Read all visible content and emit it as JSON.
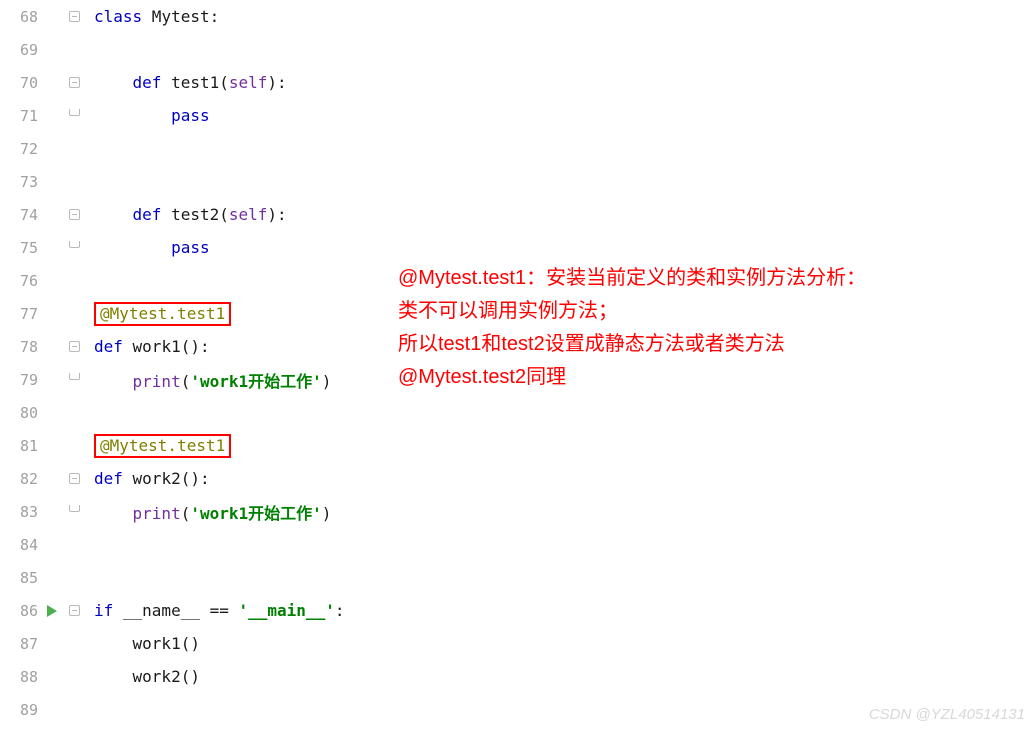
{
  "lines": {
    "l68": "68",
    "l69": "69",
    "l70": "70",
    "l71": "71",
    "l72": "72",
    "l73": "73",
    "l74": "74",
    "l75": "75",
    "l76": "76",
    "l77": "77",
    "l78": "78",
    "l79": "79",
    "l80": "80",
    "l81": "81",
    "l82": "82",
    "l83": "83",
    "l84": "84",
    "l85": "85",
    "l86": "86",
    "l87": "87",
    "l88": "88",
    "l89": "89"
  },
  "code": {
    "class_kw": "class",
    "class_name": " Mytest:",
    "def_kw": "def",
    "test1": " test1(",
    "test2": " test2(",
    "self_kw": "self",
    "close_def": "):",
    "pass_kw": "pass",
    "decorator1": "@Mytest.test1",
    "decorator2": "@Mytest.test1",
    "work1_def": " work1():",
    "work2_def": " work2():",
    "print_kw": "print",
    "print_open": "(",
    "print_close": ")",
    "work1_str": "'work1开始工作'",
    "work2_str": "'work1开始工作'",
    "if_kw": "if",
    "name_dunder": " __name__ == ",
    "main_str": "'__main__'",
    "colon": ":",
    "call_work1": "work1()",
    "call_work2": "work2()"
  },
  "annotation": {
    "l1": "@Mytest.test1：安装当前定义的类和实例方法分析：",
    "l2": "类不可以调用实例方法；",
    "l3": "所以test1和test2设置成静态方法或者类方法",
    "l4": "@Mytest.test2同理"
  },
  "watermark": "CSDN @YZL40514131"
}
